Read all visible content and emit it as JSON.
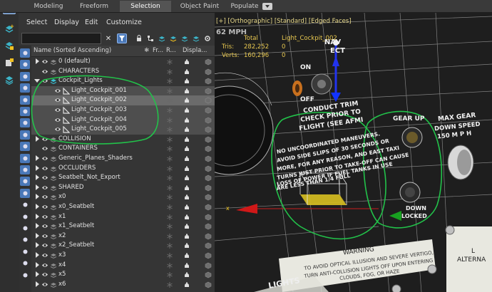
{
  "ribbon": {
    "tabs": [
      "Modeling",
      "Freeform",
      "Selection",
      "Object Paint",
      "Populate"
    ],
    "active_tab": "Selection"
  },
  "explorer": {
    "menu": [
      "Select",
      "Display",
      "Edit",
      "Customize"
    ],
    "columns": [
      "Name (Sorted Ascending)",
      "Fr...",
      "R...",
      "Displa..."
    ],
    "search_value": "",
    "rows": [
      {
        "name": "0 (default)",
        "type": "layer",
        "expander": "closed",
        "indent": 0
      },
      {
        "name": "CHARACTERS",
        "type": "layer",
        "expander": "none",
        "indent": 0
      },
      {
        "name": "Cockpit_Lights",
        "type": "layer-active",
        "expander": "open",
        "indent": 0
      },
      {
        "name": "Light_Cockpit_001",
        "type": "light",
        "expander": "none",
        "indent": 1
      },
      {
        "name": "Light_Cockpit_002",
        "type": "light",
        "expander": "none",
        "indent": 1,
        "selected": true
      },
      {
        "name": "Light_Cockpit_003",
        "type": "light",
        "expander": "none",
        "indent": 1
      },
      {
        "name": "Light_Cockpit_004",
        "type": "light",
        "expander": "none",
        "indent": 1
      },
      {
        "name": "Light_Cockpit_005",
        "type": "light",
        "expander": "none",
        "indent": 1
      },
      {
        "name": "COLLISION",
        "type": "layer",
        "expander": "closed",
        "indent": 0
      },
      {
        "name": "CONTAINERS",
        "type": "layer",
        "expander": "none",
        "indent": 0
      },
      {
        "name": "Generic_Planes_Shaders",
        "type": "layer",
        "expander": "closed",
        "indent": 0
      },
      {
        "name": "OCCLUDERS",
        "type": "layer",
        "expander": "closed",
        "indent": 0
      },
      {
        "name": "Seatbelt_Not_Export",
        "type": "layer",
        "expander": "closed",
        "indent": 0
      },
      {
        "name": "SHARED",
        "type": "layer",
        "expander": "closed",
        "indent": 0
      },
      {
        "name": "x0",
        "type": "layer",
        "expander": "closed",
        "indent": 0
      },
      {
        "name": "x0_Seatbelt",
        "type": "layer",
        "expander": "closed",
        "indent": 0
      },
      {
        "name": "x1",
        "type": "layer",
        "expander": "closed",
        "indent": 0
      },
      {
        "name": "x1_Seatbelt",
        "type": "layer",
        "expander": "closed",
        "indent": 0
      },
      {
        "name": "x2",
        "type": "layer",
        "expander": "closed",
        "indent": 0
      },
      {
        "name": "x2_Seatbelt",
        "type": "layer",
        "expander": "closed",
        "indent": 0
      },
      {
        "name": "x3",
        "type": "layer",
        "expander": "closed",
        "indent": 0
      },
      {
        "name": "x4",
        "type": "layer",
        "expander": "closed",
        "indent": 0
      },
      {
        "name": "x5",
        "type": "layer",
        "expander": "closed",
        "indent": 0
      },
      {
        "name": "x6",
        "type": "layer",
        "expander": "closed",
        "indent": 0
      }
    ]
  },
  "viewport": {
    "label": "[+] [Orthographic] [Standard] [Edged Faces]",
    "stats": {
      "col_total": "Total",
      "col_selected": "Light_Cockpit_002",
      "tris_label": "Tris:",
      "tris_total": "282,252",
      "tris_sel": "0",
      "verts_label": "Verts:",
      "verts_total": "160,296",
      "verts_sel": "0"
    },
    "panel_text": {
      "mph": "62 MPH",
      "nav": "NAV",
      "ect": "ECT",
      "on": "ON",
      "off": "OFF",
      "conduct": "CONDUCT TRIM",
      "check": "CHECK PRIOR TO",
      "flight": "FLIGHT (SEE AFMI",
      "warn1": "NO UNCOORDINATED MANEUVERS.",
      "warn2": "AVOID SIDE SLIPS OF 30 SECONDS OR",
      "warn3": "MORE, FOR ANY REASON, AND EAST TAXI",
      "warn4": "TURNS JUST PRIOR TO TAKE-OFF CAN CAUSE",
      "warn5": "LOSS OF POWER IF FUEL TANKS IN USE",
      "warn6": "ARE LESS THAN 1/4 FULL",
      "gearup": "GEAR UP",
      "maxgear": "MAX GEAR",
      "downspeed": "DOWN SPEED",
      "mph150": "150 M P H",
      "down": "DOWN",
      "locked": "LOCKED",
      "warning": "WARNING",
      "vertigo1": "TO AVOID OPTICAL ILLUSION AND SEVERE VERTIGO,",
      "vertigo2": "TURN ANTI-COLLISION LIGHTS OFF UPON ENTERING",
      "vertigo3": "CLOUDS, FOG, OR HAZE",
      "lights": "LIGHTS",
      "alterna": "ALTERNA",
      "l": "L",
      "axis_x": "x"
    }
  },
  "colors": {
    "selection_blue": "#4a78b8",
    "annotation_green": "#22c24a",
    "stats_yellow": "#e8c850"
  }
}
